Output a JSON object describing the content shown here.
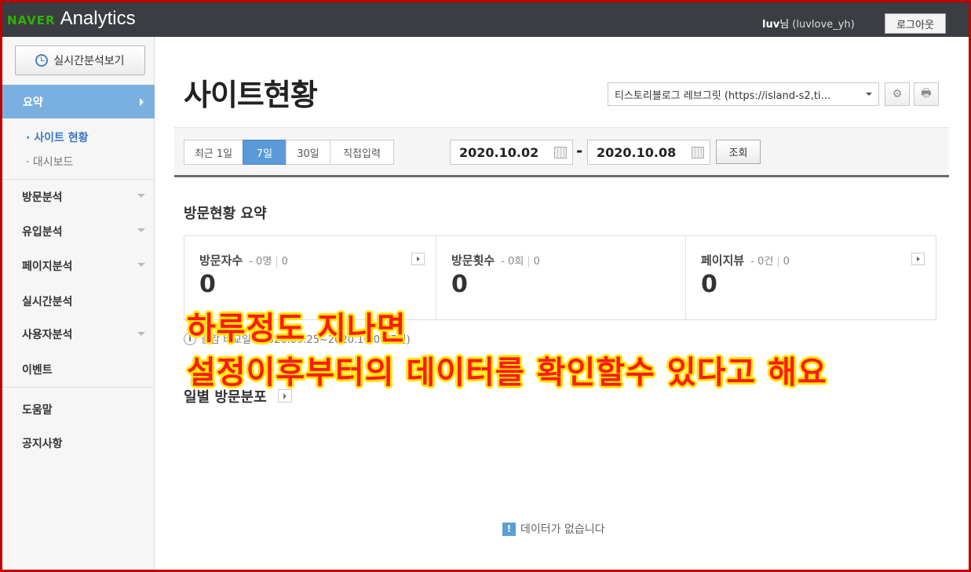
{
  "header": {
    "logo_naver": "NAVER",
    "logo_analytics": "Analytics",
    "user_name": "luv",
    "user_suffix": "님",
    "user_id": "(luvlove_yh)",
    "logout_label": "로그아웃"
  },
  "sidebar": {
    "realtime_button": "실시간분석보기",
    "active_item": "요약",
    "sub_items": [
      "· 사이트 현황",
      "· 대시보드"
    ],
    "items": [
      "방문분석",
      "유입분석",
      "페이지분석",
      "실시간분석",
      "사용자분석",
      "이벤트",
      "도움말",
      "공지사항"
    ]
  },
  "main": {
    "title": "사이트현황",
    "site_select_value": "티스토리블로그 레브그릿 (https://island-s2,ti…",
    "range_tabs": [
      "최근 1일",
      "7일",
      "30일",
      "직접입력"
    ],
    "active_range": "7일",
    "start_date": "2020.10.02",
    "date_separator": "-",
    "end_date": "2020.10.08",
    "search_label": "조회",
    "summary_title": "방문현황 요약",
    "cards": [
      {
        "label": "방문자수",
        "delta_prefix": "-",
        "delta_a": "0명",
        "delta_b": "0",
        "value": "0"
      },
      {
        "label": "방문횟수",
        "delta_prefix": "-",
        "delta_a": "0회",
        "delta_b": "0",
        "value": "0"
      },
      {
        "label": "페이지뷰",
        "delta_prefix": "-",
        "delta_a": "0건",
        "delta_b": "0",
        "value": "0"
      }
    ],
    "compare_note": "증감 비교일 : 2020.09.25~2020.10.01(7일)",
    "daily_title": "일별 방문분포",
    "no_data": "데이터가 없습니다"
  },
  "overlay": {
    "line1": "하루정도 지나면",
    "line2": "설정이후부터의 데이터를 확인할수 있다고 해요"
  },
  "colors": {
    "frame": "#c00000",
    "topbar": "#3a3d42",
    "naver_green": "#2db400",
    "active_nav": "#7ab0df",
    "active_tab": "#5b9ad8",
    "overlay_text": "#ff1a1a",
    "overlay_stroke": "#ffe600"
  }
}
